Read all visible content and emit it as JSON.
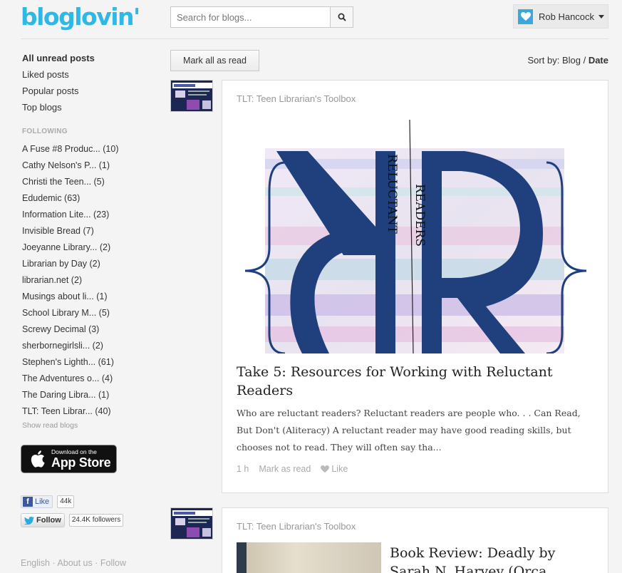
{
  "header": {
    "logo": "bloglovin'",
    "search_placeholder": "Search for blogs...",
    "user_name": "Rob Hancock"
  },
  "sidebar": {
    "nav": [
      "All unread posts",
      "Liked posts",
      "Popular posts",
      "Top blogs"
    ],
    "following_label": "FOLLOWING",
    "blogs": [
      "A Fuse #8 Produc... (10)",
      "Cathy Nelson's P... (1)",
      "Christi the Teen... (5)",
      "Edudemic (63)",
      "Information Lite... (23)",
      "Invisible Bread (7)",
      "Joeyanne Library... (2)",
      "Librarian by Day (2)",
      "librarian.net (2)",
      "Musings about li... (1)",
      "School Library M... (5)",
      "Screwy Decimal (3)",
      "sherbornegirlsli... (2)",
      "Stephen's Lighth... (61)",
      "The Adventures o... (4)",
      "The Daring Libra... (1)",
      "TLT: Teen Librar... (40)"
    ],
    "show_read": "Show read blogs",
    "app_store_small": "Download on the",
    "app_store_big": "App Store",
    "fb_like": "Like",
    "fb_count": "44k",
    "tw_follow": "Follow",
    "tw_count": "24.4K followers",
    "footer": {
      "english": "English",
      "sep": " · ",
      "about": "About us",
      "follow": "Follow"
    }
  },
  "toolbar": {
    "mark_all": "Mark all as read",
    "sort_label": "Sort by: ",
    "sort_blog": "Blog",
    "sort_sep": " / ",
    "sort_date": "Date"
  },
  "posts": [
    {
      "source": "TLT: Teen Librarian's Toolbox",
      "image_text_1": "RELUCTANT",
      "image_text_2": "READERS",
      "title": "Take 5: Resources for Working with Reluctant Readers",
      "excerpt": "Who are reluctant readers?   Reluctant readers are people who. . . Can Read, But Don't (Aliteracy) A reluctant reader may have good reading skills, but chooses not to read.  They will often say tha...",
      "time": "1 h",
      "mark_read": "Mark as read",
      "like": "Like"
    },
    {
      "source": "TLT: Teen Librarian's Toolbox",
      "title": "Book Review: Deadly by Sarah N. Harvey (Orca"
    }
  ],
  "colors": {
    "brand": "#2fb8e6",
    "logo_blue": "#1f3f7d"
  }
}
